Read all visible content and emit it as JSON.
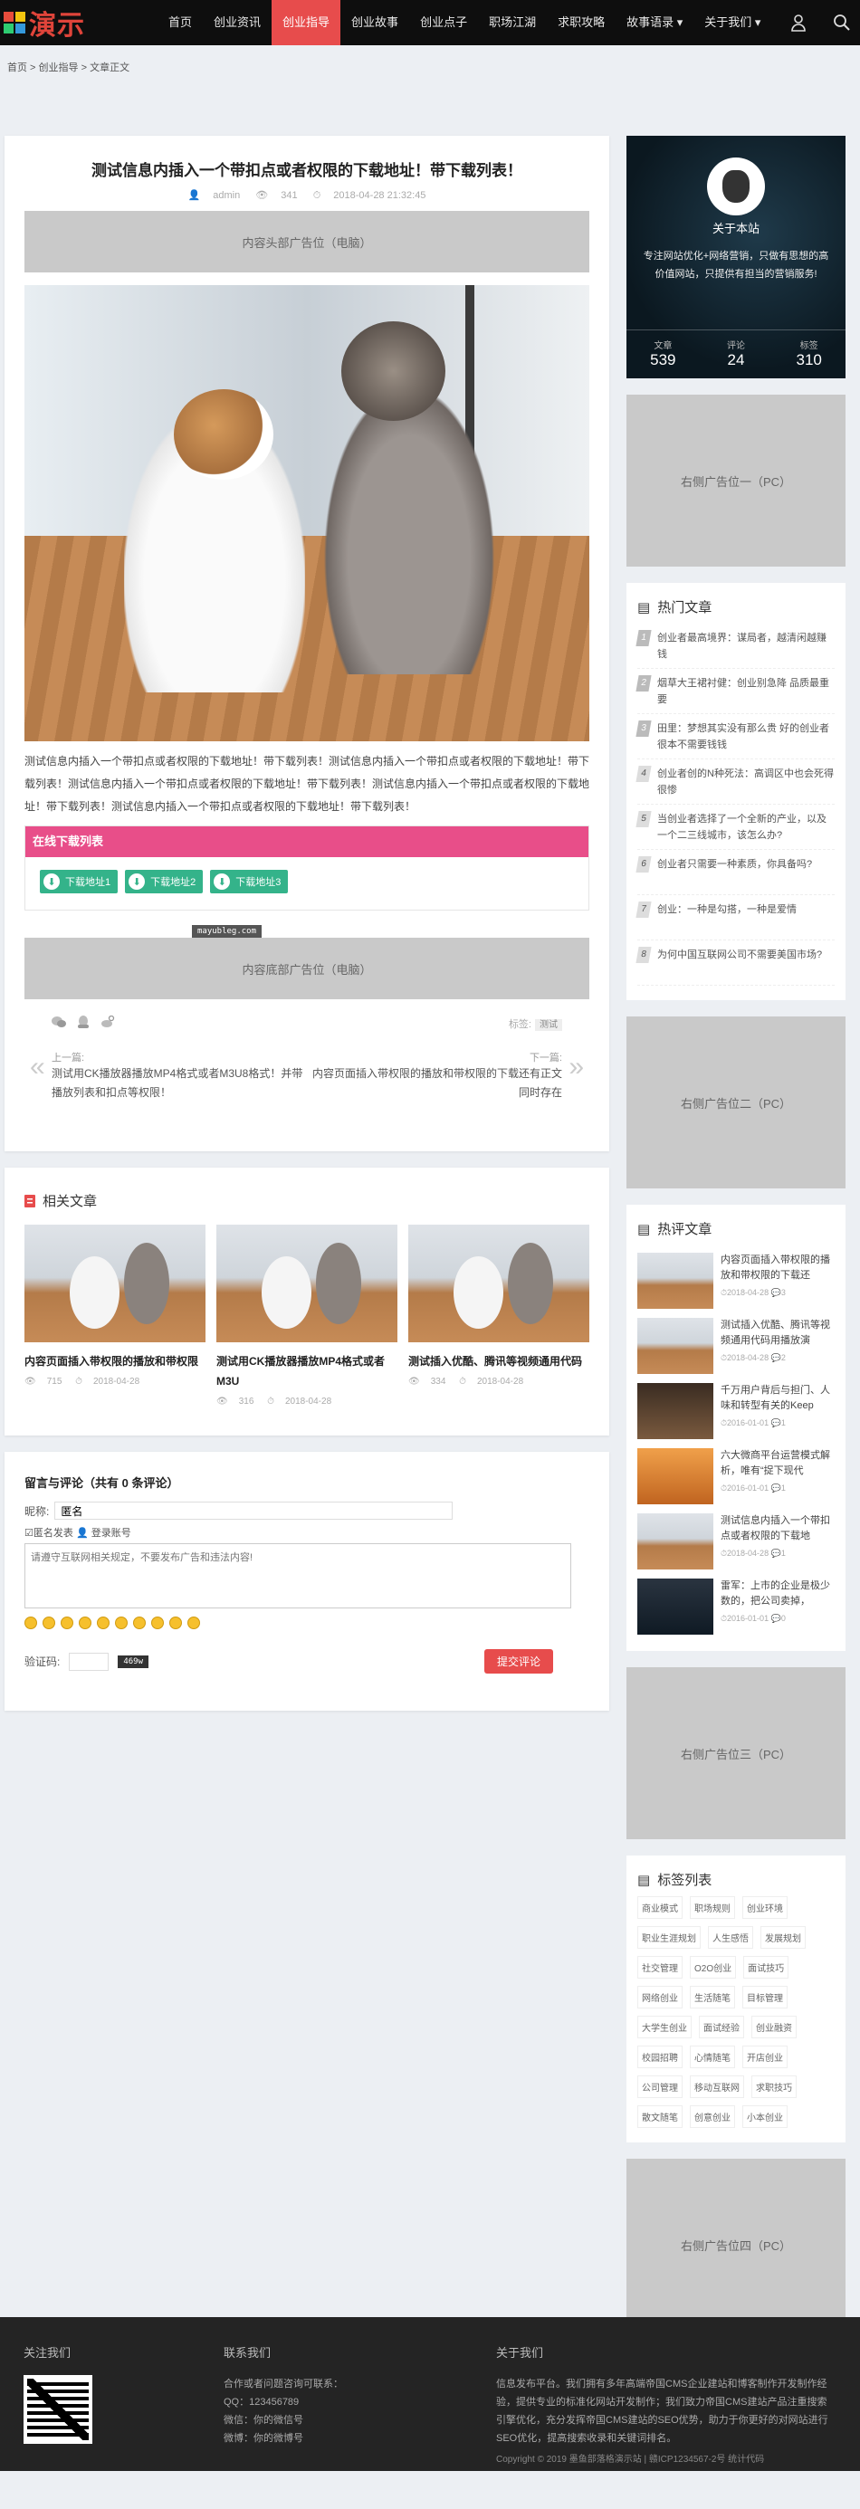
{
  "header": {
    "logo_text": "演示",
    "logo_colors": [
      "#e74c3c",
      "#f1c40f",
      "#2ecc71",
      "#3498db"
    ],
    "nav": [
      {
        "label": "首页",
        "active": false
      },
      {
        "label": "创业资讯",
        "active": false
      },
      {
        "label": "创业指导",
        "active": true
      },
      {
        "label": "创业故事",
        "active": false
      },
      {
        "label": "创业点子",
        "active": false
      },
      {
        "label": "职场江湖",
        "active": false
      },
      {
        "label": "求职攻略",
        "active": false
      },
      {
        "label": "故事语录 ▾",
        "active": false
      },
      {
        "label": "关于我们 ▾",
        "active": false
      }
    ],
    "accent_color": "#e74c4c"
  },
  "breadcrumb": [
    "首页 >",
    "创业指导 >",
    "文章正文"
  ],
  "article": {
    "title": "测试信息内插入一个带扣点或者权限的下载地址！带下载列表！",
    "author": "admin",
    "views": "341",
    "date": "2018-04-28 21:32:45",
    "ad_head": "内容头部广告位（电脑）",
    "body": "测试信息内插入一个带扣点或者权限的下载地址！带下载列表！测试信息内插入一个带扣点或者权限的下载地址！带下载列表！测试信息内插入一个带扣点或者权限的下载地址！带下载列表！测试信息内插入一个带扣点或者权限的下载地址！带下载列表！测试信息内插入一个带扣点或者权限的下载地址！带下载列表！",
    "download_title": "在线下载列表",
    "downloads": [
      "下载地址1",
      "下载地址2",
      "下载地址3"
    ],
    "watermark": "mayubleg.com",
    "ad_foot": "内容底部广告位（电脑）",
    "tags_label": "标签:",
    "tag": "测试",
    "prev_label": "上一篇:",
    "prev_title": "测试用CK播放器播放MP4格式或者M3U8格式！并带播放列表和扣点等权限！",
    "next_label": "下一篇:",
    "next_title": "内容页面插入带权限的播放和带权限的下载还有正文同时存在"
  },
  "related": {
    "title": "相关文章",
    "items": [
      {
        "title": "内容页面插入带权限的播放和带权限",
        "views": "715",
        "date": "2018-04-28"
      },
      {
        "title": "测试用CK播放器播放MP4格式或者M3U",
        "views": "316",
        "date": "2018-04-28"
      },
      {
        "title": "测试插入优酷、腾讯等视频通用代码",
        "views": "334",
        "date": "2018-04-28"
      }
    ]
  },
  "comment": {
    "title": "留言与评论（共有 0 条评论）",
    "name_label": "昵称:",
    "name_value": "匿名",
    "anon_label": "☑匿名发表",
    "login_label": "登录账号",
    "textarea_placeholder": "请遵守互联网相关规定，不要发布广告和违法内容!",
    "captcha_label": "验证码:",
    "captcha_text": "469w",
    "submit_label": "提交评论"
  },
  "sidebar": {
    "about_title": "关于本站",
    "about_desc": "专注网站优化+网络营销，只做有思想的高价值网站，只提供有担当的营销服务!",
    "stats": [
      {
        "label": "文章",
        "value": "539"
      },
      {
        "label": "评论",
        "value": "24"
      },
      {
        "label": "标签",
        "value": "310"
      }
    ],
    "ad1": "右侧广告位一（PC）",
    "hot_title": "热门文章",
    "hot": [
      "创业者最高境界：谋局者，越清闲越赚钱",
      "烟草大王裙衬健：创业别急降 品质最重要",
      "田里：梦想其实没有那么贵 好的创业者很本不需要钱钱",
      "创业者创的N种死法：高调区中也会死得很惨",
      "当创业者选择了一个全新的产业，以及一个二三线城市，该怎么办?",
      "创业者只需要一种素质，你具备吗?",
      "创业：一种是勾搭，一种是爱情",
      "为何中国互联网公司不需要美国市场?"
    ],
    "ad2": "右侧广告位二（PC）",
    "hotc_title": "热评文章",
    "hotc": [
      {
        "title": "内容页面插入带权限的播放和带权限的下载还",
        "date": "2018-04-28",
        "count": "3",
        "style": "cat"
      },
      {
        "title": "测试插入优酷、腾讯等视频通用代码用播放演",
        "date": "2018-04-28",
        "count": "2",
        "style": "cat"
      },
      {
        "title": "千万用户背后与担门、人味和转型有关的Keep",
        "date": "2016-01-01",
        "count": "1",
        "style": "dark"
      },
      {
        "title": "六大微商平台运营模式解析，唯有“捉下现代",
        "date": "2016-01-01",
        "count": "1",
        "style": "orange"
      },
      {
        "title": "测试信息内插入一个带扣点或者权限的下载地",
        "date": "2018-04-28",
        "count": "1",
        "style": "cat"
      },
      {
        "title": "雷军：上市的企业是极少数的，把公司卖掉，",
        "date": "2016-01-01",
        "count": "0",
        "style": "blue"
      }
    ],
    "ad3": "右侧广告位三（PC）",
    "tags_title": "标签列表",
    "tags": [
      "商业模式",
      "职场规则",
      "创业环境",
      "职业生涯规划",
      "人生感悟",
      "发展规划",
      "社交管理",
      "O2O创业",
      "面试技巧",
      "网络创业",
      "生活随笔",
      "目标管理",
      "大学生创业",
      "面试经验",
      "创业融资",
      "校园招聘",
      "心情随笔",
      "开店创业",
      "公司管理",
      "移动互联网",
      "求职技巧",
      "散文随笔",
      "创意创业",
      "小本创业"
    ],
    "ad4": "右侧广告位四（PC）"
  },
  "footer": {
    "follow_title": "关注我们",
    "contact_title": "联系我们",
    "contact_lines": [
      "合作或者问题咨询可联系：",
      "QQ：123456789",
      "微信：你的微信号",
      "微博：你的微博号"
    ],
    "about_title": "关于我们",
    "about_text": "信息发布平台。我们拥有多年高端帝国CMS企业建站和博客制作开发制作经验，提供专业的标准化网站开发制作；我们致力帝国CMS建站产品注重搜索引擎优化，充分发挥帝国CMS建站的SEO优势，助力于你更好的对网站进行SEO优化，提高搜索收录和关键词排名。",
    "copyright": "Copyright © 2019 墨鱼部落格演示站 | 赣ICP1234567-2号 统计代码"
  }
}
